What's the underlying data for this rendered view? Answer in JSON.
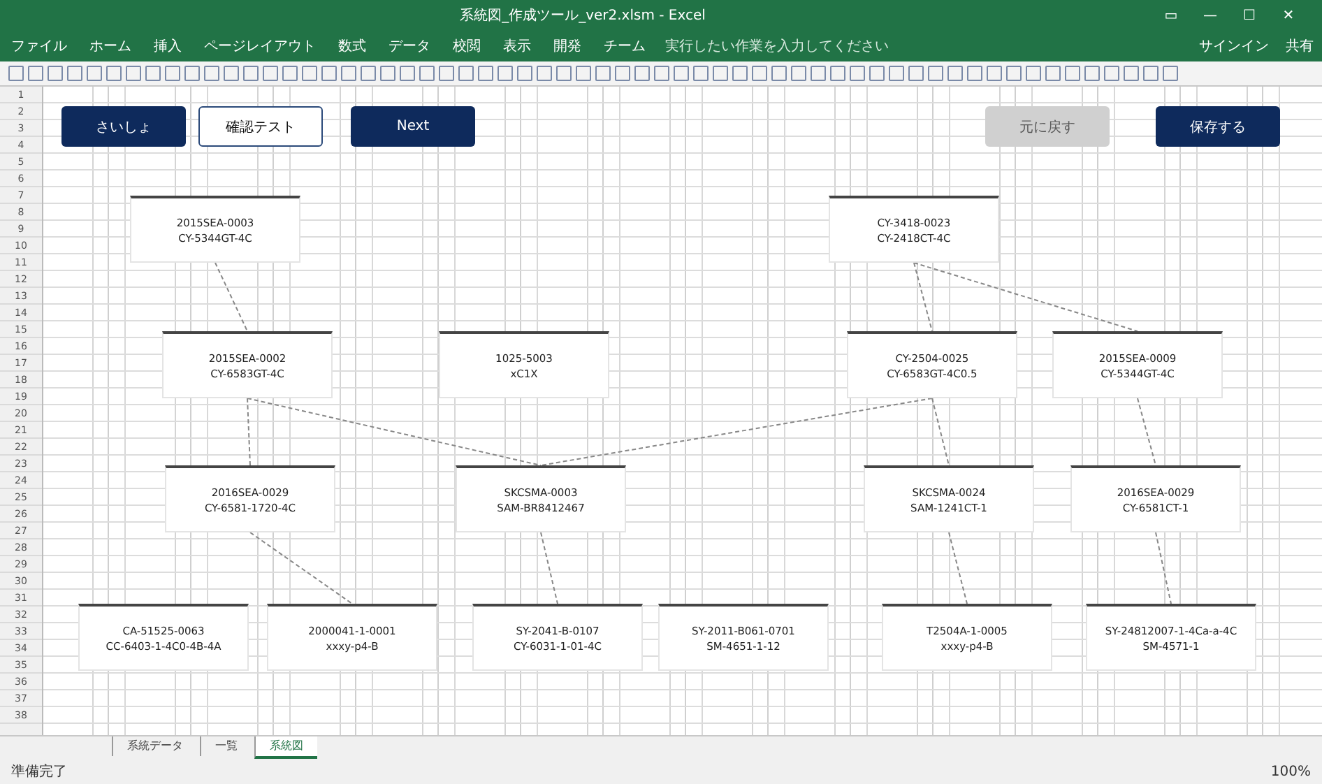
{
  "window": {
    "title": "系統図_作成ツール_ver2.xlsm - Excel",
    "controls": [
      "▭",
      "—",
      "☐",
      "✕"
    ]
  },
  "menu": {
    "items": [
      {
        "label": "ファイル",
        "selected": false
      },
      {
        "label": "ホーム",
        "selected": false
      },
      {
        "label": "挿入",
        "selected": false
      },
      {
        "label": "ページレイアウト",
        "selected": false
      },
      {
        "label": "数式",
        "selected": false
      },
      {
        "label": "データ",
        "selected": false
      },
      {
        "label": "校閲",
        "selected": false
      },
      {
        "label": "表示",
        "selected": false
      },
      {
        "label": "開発",
        "selected": false
      },
      {
        "label": "チーム",
        "selected": false
      }
    ],
    "tell_me": "実行したい作業を入力してください",
    "signin": "サインイン",
    "share": "共有"
  },
  "sheet": {
    "row_numbers": [
      "1",
      "2",
      "3",
      "4",
      "5",
      "6",
      "7",
      "8",
      "9",
      "10",
      "11",
      "12",
      "13",
      "14",
      "15",
      "16",
      "17",
      "18",
      "19",
      "20",
      "21",
      "22",
      "23",
      "24",
      "25",
      "26",
      "27",
      "28",
      "29",
      "30",
      "31",
      "32",
      "33",
      "34",
      "35",
      "36",
      "37",
      "38"
    ],
    "buttons": [
      {
        "label": "さいしょ",
        "kind": "primary",
        "disabled": false
      },
      {
        "label": "確認テスト",
        "kind": "outline",
        "disabled": false
      },
      {
        "label": "Next",
        "kind": "primary",
        "disabled": false
      },
      {
        "label": "元に戻す",
        "kind": "primary",
        "disabled": true
      },
      {
        "label": "保存する",
        "kind": "primary",
        "disabled": false
      }
    ],
    "nodes": [
      {
        "line1": "2015SEA-0003",
        "line2": "CY-5344GT-4C"
      },
      {
        "line1": "CY-3418-0023",
        "line2": "CY-2418CT-4C"
      },
      {
        "line1": "2015SEA-0002",
        "line2": "CY-6583GT-4C"
      },
      {
        "line1": "1025-5003",
        "line2": "xC1X"
      },
      {
        "line1": "CY-2504-0025",
        "line2": "CY-6583GT-4C0.5"
      },
      {
        "line1": "2015SEA-0009",
        "line2": "CY-5344GT-4C"
      },
      {
        "line1": "2016SEA-0029",
        "line2": "CY-6581-1720-4C"
      },
      {
        "line1": "SKCSMA-0003",
        "line2": "SAM-BR8412467"
      },
      {
        "line1": "SKCSMA-0024",
        "line2": "SAM-1241CT-1"
      },
      {
        "line1": "2016SEA-0029",
        "line2": "CY-6581CT-1"
      },
      {
        "line1": "CA-51525-0063",
        "line2": "CC-6403-1-4C0-4B-4A"
      },
      {
        "line1": "2000041-1-0001",
        "line2": "xxxy-p4-B"
      },
      {
        "line1": "SY-2041-B-0107",
        "line2": "CY-6031-1-01-4C"
      },
      {
        "line1": "SY-2011-B061-0701",
        "line2": "SM-4651-1-12"
      },
      {
        "line1": "T2504A-1-0005",
        "line2": "xxxy-p4-B"
      },
      {
        "line1": "SY-24812007-1-4Ca-a-4C",
        "line2": "SM-4571-1"
      }
    ]
  },
  "sheet_tabs": [
    {
      "label": "系統データ",
      "selected": false
    },
    {
      "label": "一覧",
      "selected": false
    },
    {
      "label": "系統図",
      "selected": true
    }
  ],
  "status_bar": {
    "text": "準備完了",
    "zoom": "100%"
  }
}
